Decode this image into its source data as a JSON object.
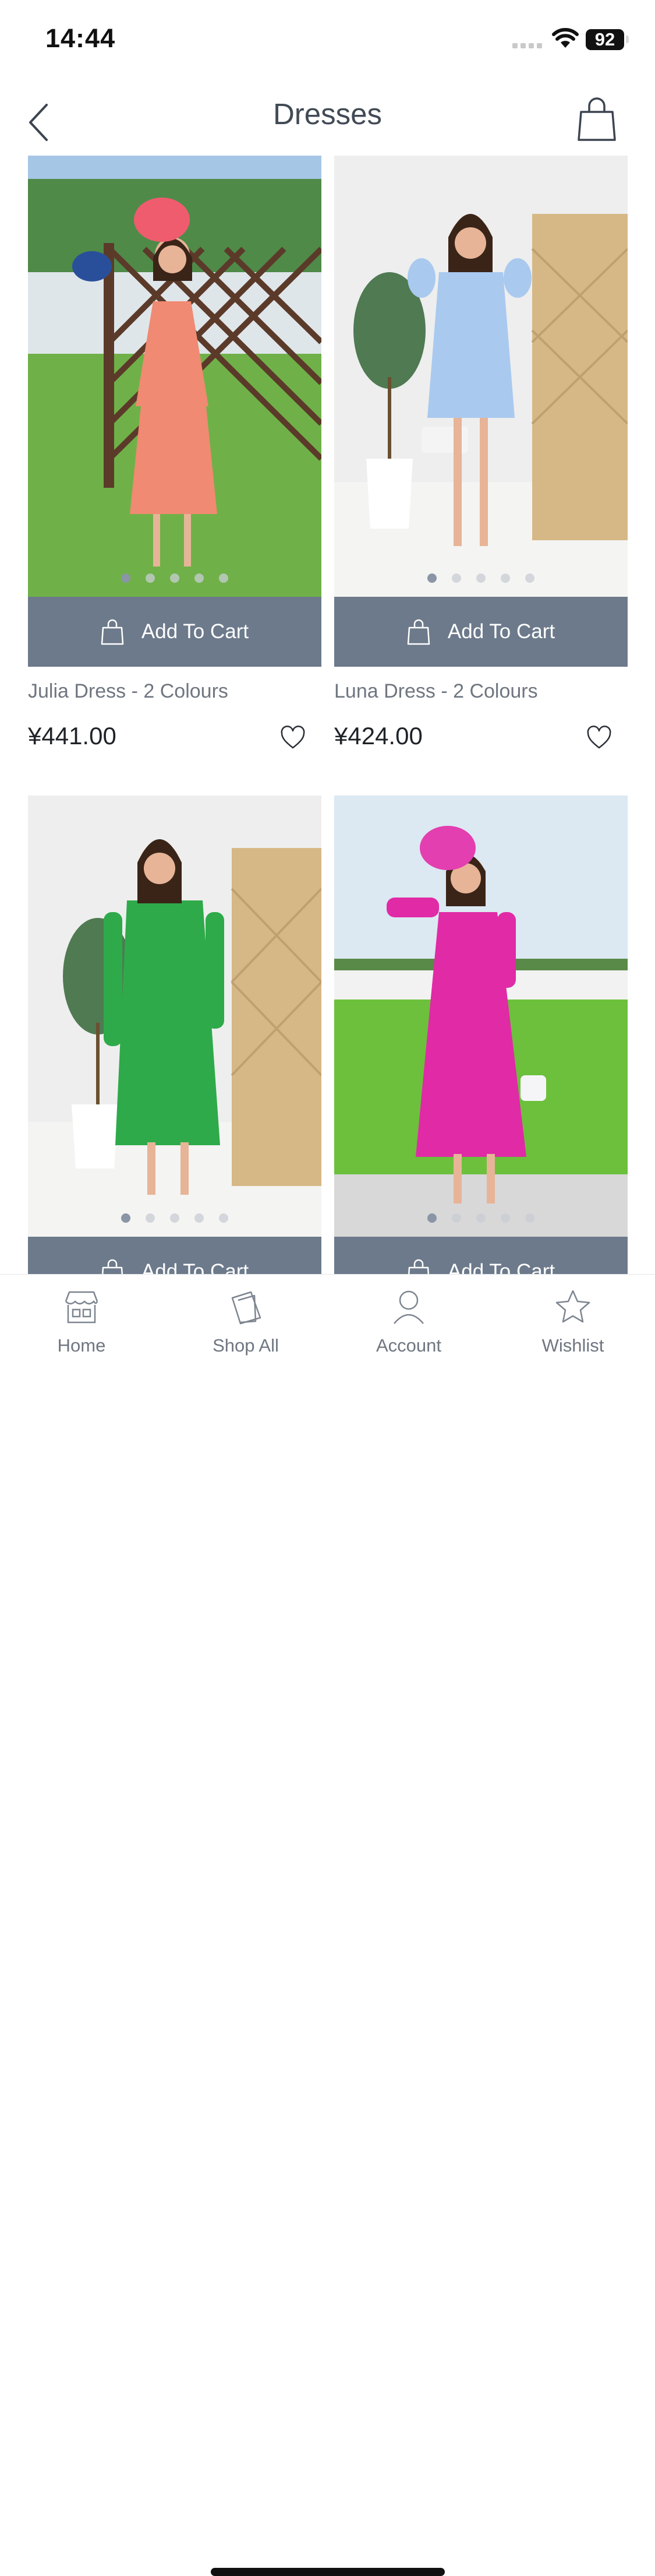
{
  "status_bar": {
    "time": "14:44",
    "battery": "92"
  },
  "header": {
    "title": "Dresses",
    "back_icon": "chevron-left-icon",
    "cart_icon": "shopping-bag-icon"
  },
  "products": [
    {
      "name": "Julia Dress - 2 Colours",
      "price": "¥441.00",
      "add_to_cart": "Add To Cart",
      "dress_color": "#f08a72",
      "image_dots": 5
    },
    {
      "name": "Luna Dress - 2 Colours",
      "price": "¥424.00",
      "add_to_cart": "Add To Cart",
      "dress_color": "#a9c9ef",
      "image_dots": 5
    },
    {
      "name": "",
      "price": "",
      "add_to_cart": "Add To Cart",
      "dress_color": "#2eaa4a",
      "image_dots": 5
    },
    {
      "name": "",
      "price": "",
      "add_to_cart": "Add To Cart",
      "dress_color": "#e02aa6",
      "image_dots": 5
    }
  ],
  "tabbar": {
    "items": [
      {
        "label": "Home",
        "icon": "storefront-icon"
      },
      {
        "label": "Shop All",
        "icon": "shopping-bag-tilted-icon"
      },
      {
        "label": "Account",
        "icon": "person-icon"
      },
      {
        "label": "Wishlist",
        "icon": "star-icon"
      }
    ]
  },
  "colors": {
    "accent": "#6c7a8b",
    "text": "#414a55",
    "muted": "#6f7680"
  }
}
